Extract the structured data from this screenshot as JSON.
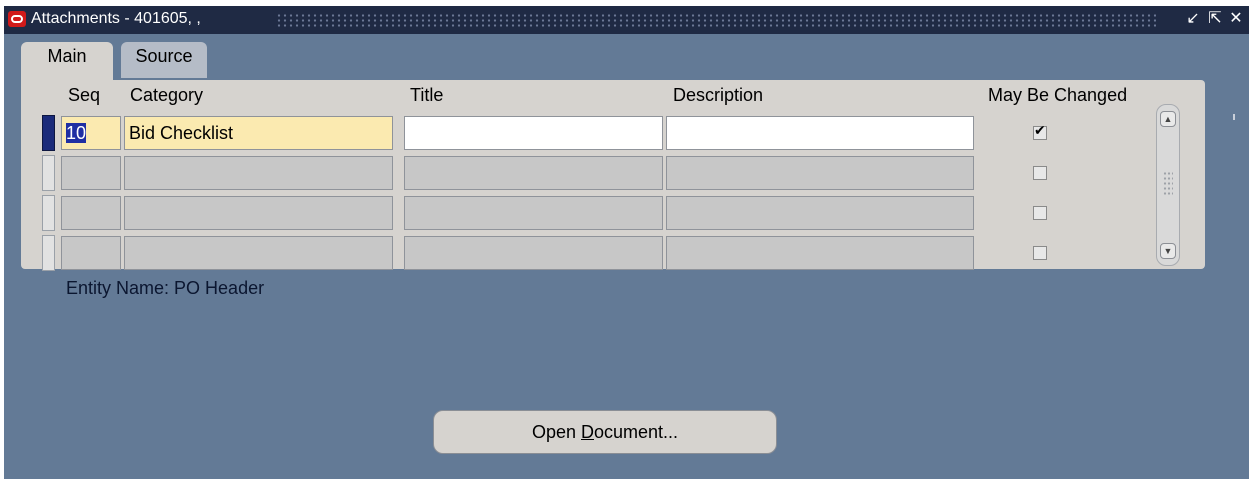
{
  "window": {
    "title": "Attachments - 401605, ,",
    "min_icon": "↙",
    "max_icon": "⇱",
    "close_icon": "✕"
  },
  "tabs": [
    {
      "label": "Main",
      "active": true
    },
    {
      "label": "Source",
      "active": false
    }
  ],
  "columns": {
    "seq": "Seq",
    "category": "Category",
    "title": "Title",
    "description": "Description",
    "may_be_changed": "May Be Changed"
  },
  "rows": [
    {
      "seq": "10",
      "category": "Bid Checklist",
      "title": "",
      "description": "",
      "may_be_changed": true
    },
    {
      "seq": "",
      "category": "",
      "title": "",
      "description": "",
      "may_be_changed": false
    },
    {
      "seq": "",
      "category": "",
      "title": "",
      "description": "",
      "may_be_changed": false
    },
    {
      "seq": "",
      "category": "",
      "title": "",
      "description": "",
      "may_be_changed": false
    }
  ],
  "entity": "Entity Name:  PO Header",
  "open_button": {
    "prefix": "Open ",
    "mnemonic": "D",
    "suffix": "ocument..."
  }
}
